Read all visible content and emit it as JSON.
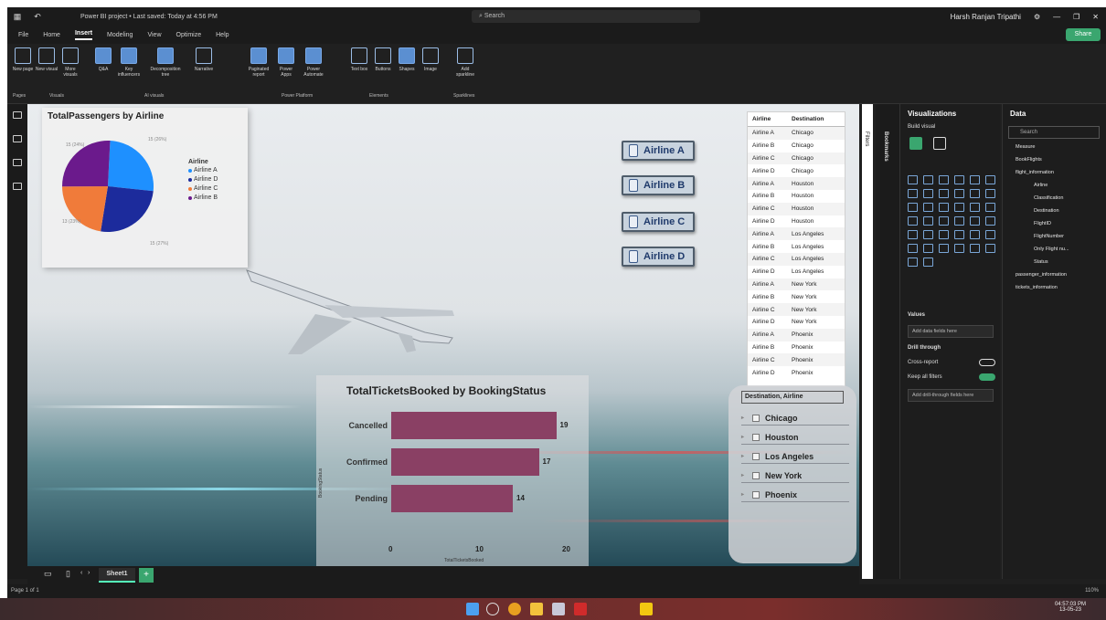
{
  "titlebar": {
    "title": "Power BI project • Last saved: Today at 4:56 PM",
    "search": "Search",
    "user": "Harsh Ranjan Tripathi"
  },
  "menubar": {
    "tabs": [
      "File",
      "Home",
      "Insert",
      "Modeling",
      "View",
      "Optimize",
      "Help"
    ],
    "active": "Insert",
    "share": "Share"
  },
  "ribbon": {
    "buttons": [
      {
        "label": "New page",
        "icon": "new-page-icon"
      },
      {
        "label": "New visual",
        "icon": "new-visual-icon"
      },
      {
        "label": "More visuals",
        "icon": "more-visuals-icon"
      },
      {
        "label": "Q&A",
        "icon": "qa-icon"
      },
      {
        "label": "Key influencers",
        "icon": "key-influencers-icon"
      },
      {
        "label": "Decomposition tree",
        "icon": "decomposition-tree-icon"
      },
      {
        "label": "Narrative",
        "icon": "narrative-icon"
      },
      {
        "label": "Paginated report",
        "icon": "paginated-report-icon"
      },
      {
        "label": "Power Apps",
        "icon": "power-apps-icon"
      },
      {
        "label": "Power Automate",
        "icon": "power-automate-icon"
      },
      {
        "label": "Text box",
        "icon": "text-box-icon"
      },
      {
        "label": "Buttons",
        "icon": "buttons-icon"
      },
      {
        "label": "Shapes",
        "icon": "shapes-icon"
      },
      {
        "label": "Image",
        "icon": "image-icon"
      },
      {
        "label": "Add sparkline",
        "icon": "sparkline-icon"
      }
    ],
    "groups": [
      "Pages",
      "Visuals",
      "AI visuals",
      "Power Platform",
      "Elements",
      "Sparklines"
    ]
  },
  "pie_card": {
    "title": "TotalPassengers by Airline",
    "legend_title": "Airline",
    "labels": {
      "tl": "15 (24%)",
      "tr": "15 (26%)",
      "bl": "13 (23%)",
      "br": "15 (27%)"
    }
  },
  "bar_card": {
    "title": "TotalTicketsBooked by BookingStatus",
    "ylabel": "BookingStatus",
    "xlabel": "TotalTicketsBooked",
    "ticks": [
      "0",
      "10",
      "20"
    ]
  },
  "airline_buttons": [
    "Airline A",
    "Airline B",
    "Airline C",
    "Airline D"
  ],
  "table": {
    "headers": [
      "Airline",
      "Destination"
    ],
    "rows": [
      [
        "Airline A",
        "Chicago"
      ],
      [
        "Airline B",
        "Chicago"
      ],
      [
        "Airline C",
        "Chicago"
      ],
      [
        "Airline D",
        "Chicago"
      ],
      [
        "Airline A",
        "Houston"
      ],
      [
        "Airline B",
        "Houston"
      ],
      [
        "Airline C",
        "Houston"
      ],
      [
        "Airline D",
        "Houston"
      ],
      [
        "Airline A",
        "Los Angeles"
      ],
      [
        "Airline B",
        "Los Angeles"
      ],
      [
        "Airline C",
        "Los Angeles"
      ],
      [
        "Airline D",
        "Los Angeles"
      ],
      [
        "Airline A",
        "New York"
      ],
      [
        "Airline B",
        "New York"
      ],
      [
        "Airline C",
        "New York"
      ],
      [
        "Airline D",
        "New York"
      ],
      [
        "Airline A",
        "Phoenix"
      ],
      [
        "Airline B",
        "Phoenix"
      ],
      [
        "Airline C",
        "Phoenix"
      ],
      [
        "Airline D",
        "Phoenix"
      ]
    ]
  },
  "dest_slicer": {
    "header": "Destination, Airline",
    "items": [
      "Chicago",
      "Houston",
      "Los Angeles",
      "New York",
      "Phoenix"
    ]
  },
  "page_tabs": {
    "tab": "Sheet1"
  },
  "filters_label": "Filters",
  "bookmarks_label": "Bookmarks",
  "viz_pane": {
    "title": "Visualizations",
    "build_visual": "Build visual",
    "values": "Values",
    "values_field": "Add data fields here",
    "drill_through": "Drill through",
    "cross_report": "Cross-report",
    "keep_filters": "Keep all filters",
    "drill_field": "Add drill-through fields here"
  },
  "data_pane": {
    "title": "Data",
    "search": "Search",
    "items": [
      "Measure",
      "BookFlights",
      "flight_information",
      "Airline",
      "Classification",
      "Destination",
      "FlightID",
      "FlightNumber",
      "Only Flight nu...",
      "Status",
      "passenger_information",
      "tickets_information"
    ]
  },
  "statusbar": {
    "page": "Page 1 of 1",
    "zoom": "110%"
  },
  "taskbar": {
    "time": "04:57:03 PM",
    "date": "13-05-23"
  },
  "colors": {
    "airline_a": "#1e90ff",
    "airline_b": "#6b1a8c",
    "airline_c": "#f07b3a",
    "airline_d": "#1c2b9c",
    "bar": "#8a4064",
    "accent": "#3aa66f"
  },
  "chart_data": [
    {
      "type": "pie",
      "title": "TotalPassengers by Airline",
      "legend_title": "Airline",
      "categories": [
        "Airline A",
        "Airline D",
        "Airline C",
        "Airline B"
      ],
      "values": [
        15,
        15,
        13,
        15
      ],
      "labels": [
        "15 (26%)",
        "15 (27%)",
        "13 (23%)",
        "15 (24%)"
      ]
    },
    {
      "type": "bar",
      "orientation": "horizontal",
      "title": "TotalTicketsBooked by BookingStatus",
      "categories": [
        "Cancelled",
        "Confirmed",
        "Pending"
      ],
      "values": [
        19,
        17,
        14
      ],
      "xlabel": "TotalTicketsBooked",
      "ylabel": "BookingStatus",
      "xlim": [
        0,
        20
      ]
    }
  ]
}
